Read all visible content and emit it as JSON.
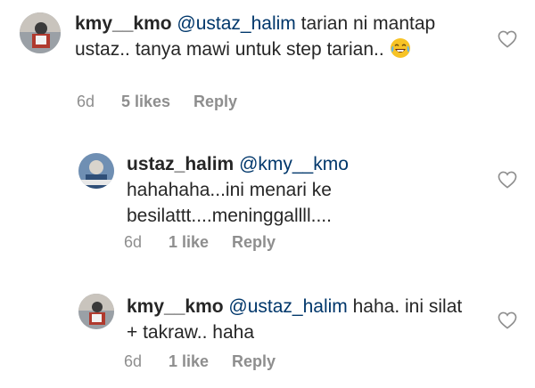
{
  "comments": [
    {
      "username": "kmy__kmo",
      "mention": "@ustaz_halim",
      "text": " tarian ni mantap ustaz.. tanya mawi untuk step tarian..",
      "emoji": "tears-of-joy",
      "time": "6d",
      "likes": "5 likes",
      "reply": "Reply"
    },
    {
      "username": "ustaz_halim",
      "mention": "@kmy__kmo",
      "text": "hahahaha...ini menari ke besilattt....meninggallll....",
      "time": "6d",
      "likes": "1 like",
      "reply": "Reply"
    },
    {
      "username": "kmy__kmo",
      "mention": "@ustaz_halim",
      "text": " haha. ini silat + takraw.. haha",
      "time": "6d",
      "likes": "1 like",
      "reply": "Reply"
    }
  ],
  "icons": {
    "like": "heart-outline-icon",
    "emoji": "tears-of-joy-emoji"
  },
  "colors": {
    "text": "#262626",
    "mention": "#00376b",
    "meta": "#8e8e8e"
  }
}
